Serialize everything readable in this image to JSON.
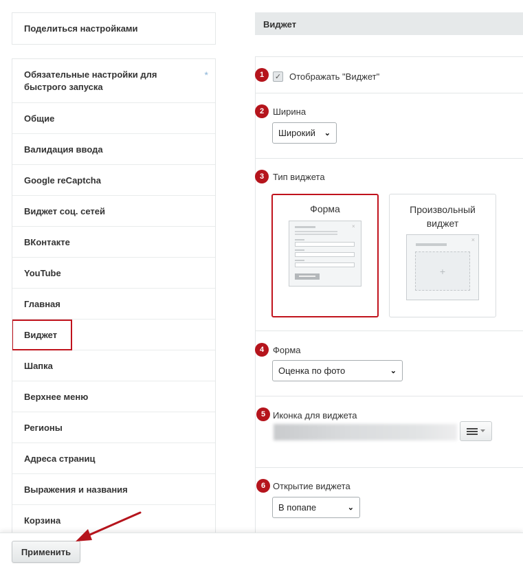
{
  "sidebar": {
    "share_label": "Поделиться настройками",
    "items": [
      {
        "label": "Обязательные настройки для быстрого запуска",
        "star": "*"
      },
      {
        "label": "Общие"
      },
      {
        "label": "Валидация ввода"
      },
      {
        "label": "Google reCaptcha"
      },
      {
        "label": "Виджет соц. сетей"
      },
      {
        "label": "ВКонтакте"
      },
      {
        "label": "YouTube"
      },
      {
        "label": "Главная"
      },
      {
        "label": "Виджет",
        "active": true
      },
      {
        "label": "Шапка"
      },
      {
        "label": "Верхнее меню"
      },
      {
        "label": "Регионы"
      },
      {
        "label": "Адреса страниц"
      },
      {
        "label": "Выражения и названия"
      },
      {
        "label": "Корзина"
      }
    ]
  },
  "panel": {
    "title": "Виджет",
    "show_widget": {
      "badge": "1",
      "label": "Отображать \"Виджет\"",
      "checked": true
    },
    "width": {
      "badge": "2",
      "label": "Ширина",
      "value": "Широкий"
    },
    "widget_type": {
      "badge": "3",
      "label": "Тип виджета",
      "options": [
        {
          "label": "Форма",
          "selected": true
        },
        {
          "label": "Произвольный виджет",
          "selected": false
        }
      ],
      "plus": "+"
    },
    "form": {
      "badge": "4",
      "label": "Форма",
      "value": "Оценка по фото"
    },
    "icon": {
      "badge": "5",
      "label": "Иконка для виджета",
      "icon": "hamburger-icon"
    },
    "opening": {
      "badge": "6",
      "label": "Открытие виджета",
      "value": "В попапе"
    }
  },
  "footer": {
    "apply_label": "Применить"
  },
  "colors": {
    "accent_red": "#c0121c",
    "badge_red": "#b5141c",
    "header_gray": "#e6e9ea"
  }
}
